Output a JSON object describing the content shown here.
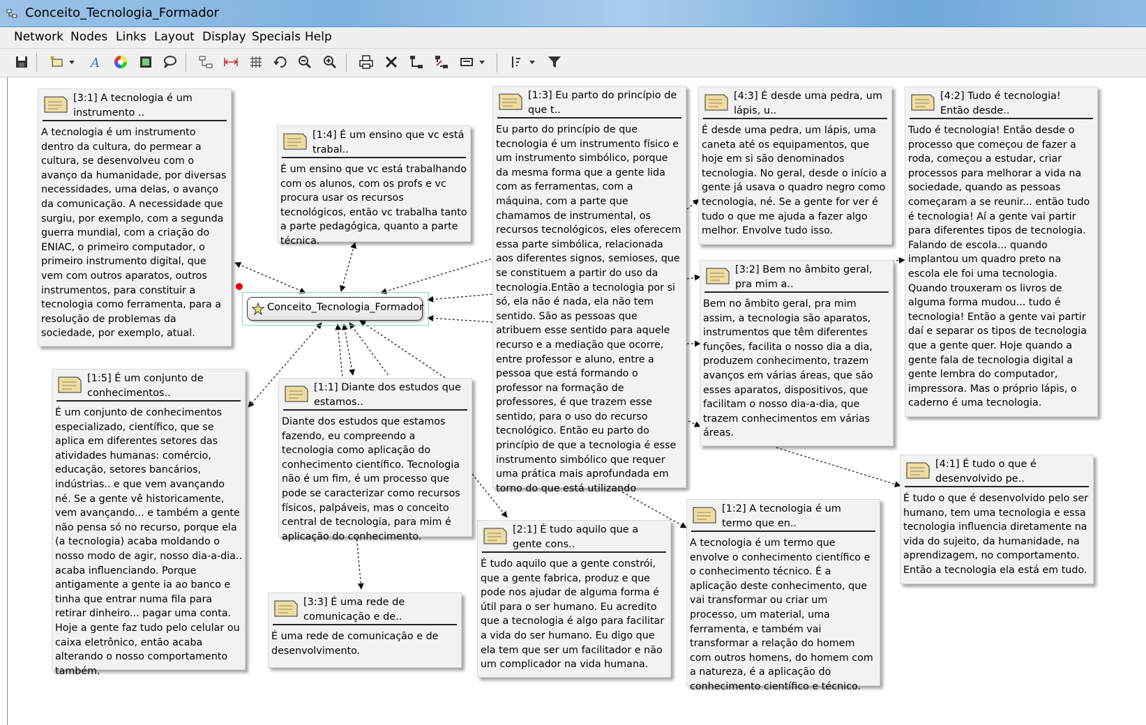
{
  "window": {
    "title": "Conceito_Tecnologia_Formador"
  },
  "menu": [
    "Network",
    "Nodes",
    "Links",
    "Layout",
    "Display",
    "Specials",
    "Help"
  ],
  "center_node": {
    "label": "Conceito_Tecnologia_Formador"
  },
  "cards": [
    {
      "id": "3:1",
      "title": "[3:1] A tecnologia é um instrumento ..",
      "body": "A tecnologia é um instrumento dentro da cultura, do permear a cultura, se desenvolveu com o avanço da humanidade, por diversas necessidades, uma delas, o avanço da comunicação. A necessidade que surgiu, por exemplo, com a segunda guerra mundial, com a criação do ENIAC, o primeiro computador, o primeiro instrumento digital, que vem com outros aparatos, outros instrumentos, para constituir a tecnologia como ferramenta, para a resolução de problemas da sociedade, por exemplo, atual."
    },
    {
      "id": "1:4",
      "title": "[1:4] É um ensino que vc está trabal..",
      "body": "É um ensino que vc está trabalhando com os alunos, com os profs e vc procura usar os recursos tecnológicos, então vc trabalha tanto a parte pedagógica, quanto a parte técnica."
    },
    {
      "id": "1:3",
      "title": "[1:3] Eu parto do princípio de que t..",
      "body": "Eu parto do princípio de que tecnologia é um instrumento físico e um instrumento simbólico, porque da mesma forma que a gente lida com as ferramentas, com a máquina, com a parte que chamamos de instrumental, os recursos tecnológicos, eles oferecem essa parte simbólica, relacionada aos diferentes signos, semioses, que se constituem a partir do uso da tecnologia.Então a tecnologia por si só, ela não é nada, ela não tem sentido. São as pessoas que atribuem esse sentido para aquele recurso e a mediação que ocorre, entre professor e aluno, entre a pessoa que está formando o professor na formação de professores, é que trazem esse sentido, para o uso do recurso tecnológico. Então eu parto do princípio de que a tecnologia é esse instrumento simbólico que requer  uma prática mais aprofundada em torno do que está utilizando"
    },
    {
      "id": "4:3",
      "title": "[4:3] É desde uma pedra, um lápis, u..",
      "body": "É desde uma pedra, um lápis, uma caneta até os equipamentos, que hoje em si são denominados tecnologia. No geral, desde o início a gente já usava o quadro negro como tecnologia, né. Se a gente for ver é tudo o que me ajuda a fazer algo melhor. Envolve tudo isso."
    },
    {
      "id": "4:2",
      "title": "[4:2] Tudo é tecnologia! Então desde..",
      "body": "Tudo é tecnologia! Então desde o processo que começou de fazer a roda, começou a estudar, criar processos para melhorar a vida na sociedade, quando as pessoas começaram a se reunir... então tudo é tecnologia! Aí a gente vai partir para diferentes tipos de tecnologia. Falando de escola... quando implantou um quadro preto na escola ele foi uma tecnologia. Quando trouxeram os livros de alguma forma mudou... tudo é tecnologia! Então a gente vai partir daí e separar os tipos de tecnologia que a gente quer. Hoje quando a gente fala de tecnologia digital a gente lembra do computador, impressora. Mas o próprio lápis, o caderno é uma tecnologia."
    },
    {
      "id": "3:2",
      "title": "[3:2] Bem no âmbito geral, pra mim a..",
      "body": "Bem no âmbito geral, pra mim assim, a tecnologia são aparatos, instrumentos que têm diferentes funções, facilita o nosso dia a dia, produzem conhecimento, trazem avanços em várias áreas, que são esses aparatos, dispositivos, que facilitam o nosso dia-a-dia, que trazem conhecimentos em várias áreas."
    },
    {
      "id": "1:5",
      "title": "[1:5] É um conjunto de conhecimentos..",
      "body": "É um conjunto de conhecimentos especializado, científico, que se aplica em diferentes setores das atividades humanas: comércio, educação, setores bancários, indústrias.. e que vem avançando né. Se a gente vê historicamente, vem avançando... e também a gente não pensa só no recurso, porque ela (a tecnologia) acaba moldando o nosso modo de agir, nosso dia-a-dia.. acaba influenciando. Porque antigamente a gente ia ao banco e tinha que entrar numa fila para retirar dinheiro... pagar uma conta. Hoje a gente faz tudo pelo celular ou caixa eletrônico, então acaba alterando o nosso comportamento também."
    },
    {
      "id": "1:1",
      "title": "[1:1] Diante dos estudos que estamos..",
      "body": "Diante dos estudos que estamos fazendo, eu compreendo a tecnologia como aplicação do conhecimento científico. Tecnologia não é um fim, é um processo que pode se caracterizar como recursos físicos, palpáveis, mas o conceito central de tecnologia, para mim é aplicação do conhecimento."
    },
    {
      "id": "4:1",
      "title": "[4:1] É tudo o que é desenvolvido pe..",
      "body": "É tudo o que é desenvolvido pelo ser humano, tem uma tecnologia e essa tecnologia influencia diretamente na vida do sujeito, da humanidade, na aprendizagem, no comportamento. Então a tecnologia ela está em tudo."
    },
    {
      "id": "1:2",
      "title": "[1:2] A tecnologia é um termo que en..",
      "body": "A tecnologia é um termo que envolve o conhecimento científico e o conhecimento técnico. É a aplicação deste conhecimento, que vai transformar ou criar um processo, um material, uma ferramenta, e também vai transformar a relação do homem com outros homens, do homem com a natureza, é a aplicação do conhecimento científico e técnico."
    },
    {
      "id": "2:1",
      "title": "[2:1] É tudo aquilo que a gente cons..",
      "body": "É tudo aquilo que a gente constrói, que a gente fabrica, produz e que pode nos ajudar de alguma forma é útil para o ser humano. Eu acredito que a tecnologia é algo para facilitar a vida do ser humano. Eu digo que ela tem que ser um facilitador e não um complicador na vida humana."
    },
    {
      "id": "3:3",
      "title": "[3:3] É uma rede de comunicação e de..",
      "body": "É uma rede de comunicação e de desenvolvimento."
    }
  ],
  "colors": {
    "accent_frame": "#7fd7c7",
    "marker": "#e00000"
  },
  "icons": [
    "save-icon",
    "new-node-icon",
    "font-icon",
    "color-wheel-icon",
    "frame-icon",
    "comment-icon",
    "tree-layout-icon",
    "spread-icon",
    "grid-icon",
    "undo-icon",
    "zoom-out-icon",
    "zoom-in-icon",
    "print-icon",
    "delete-icon",
    "link-icon",
    "unlink-icon",
    "display-icon",
    "sort-icon",
    "filter-icon"
  ]
}
